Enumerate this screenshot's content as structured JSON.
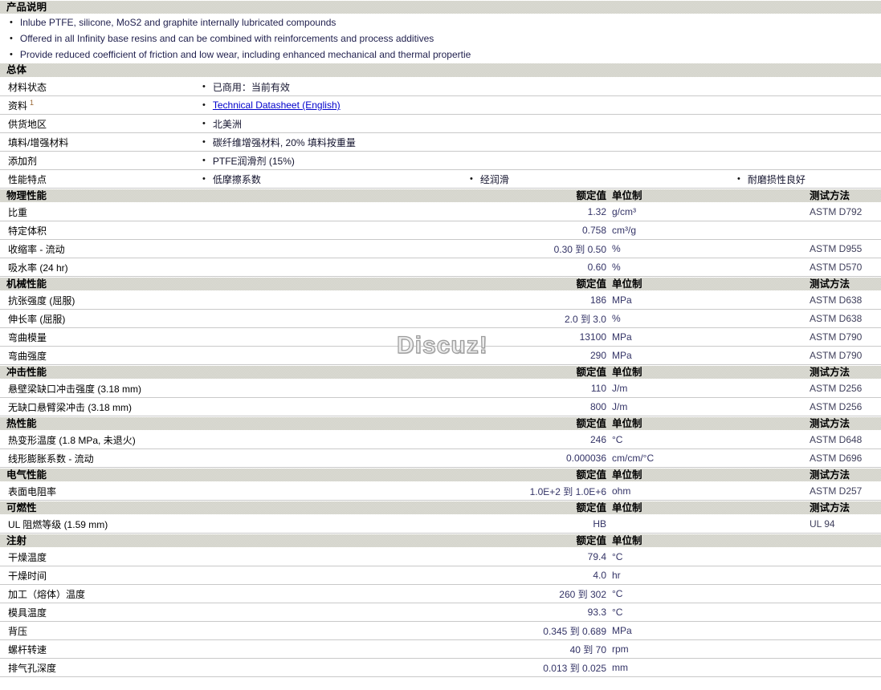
{
  "icons": {
    "bullet": "•"
  },
  "colors": {
    "link_blue": "#0000cc",
    "value_navy": "#333366",
    "header_gray": "#d6d6ce"
  },
  "watermark": "Discuz!",
  "product_description": {
    "title": "产品说明",
    "bullets": [
      "Inlube PTFE, silicone, MoS2 and graphite internally lubricated compounds",
      "Offered in all Infinity base resins and can be combined with reinforcements and process additives",
      "Provide reduced coefficient of friction and low wear, including enhanced mechanical and thermal propertie"
    ]
  },
  "general": {
    "title": "总体",
    "rows": [
      {
        "label": "材料状态",
        "sup": "",
        "values": [
          "已商用：当前有效"
        ]
      },
      {
        "label": "资料",
        "sup": "1",
        "values": [
          "Technical Datasheet (English)"
        ],
        "link": true
      },
      {
        "label": "供货地区",
        "sup": "",
        "values": [
          "北美洲"
        ]
      },
      {
        "label": "填料/增强材料",
        "sup": "",
        "values": [
          "碳纤维增强材料, 20% 填料按重量"
        ]
      },
      {
        "label": "添加剂",
        "sup": "",
        "values": [
          "PTFE润滑剂 (15%)"
        ]
      },
      {
        "label": "性能特点",
        "sup": "",
        "values": [
          "低摩擦系数",
          "经润滑",
          "耐磨损性良好"
        ]
      }
    ]
  },
  "columns": {
    "value_header": "额定值",
    "unit_header": "单位制",
    "method_header": "测试方法"
  },
  "sections": [
    {
      "title": "物理性能",
      "rows": [
        {
          "property": "比重",
          "value": "1.32",
          "unit": "g/cm³",
          "method": "ASTM D792"
        },
        {
          "property": "特定体积",
          "value": "0.758",
          "unit": "cm³/g",
          "method": ""
        },
        {
          "property": "收缩率 - 流动",
          "value": "0.30 到 0.50",
          "unit": "%",
          "method": "ASTM D955"
        },
        {
          "property": "吸水率 (24 hr)",
          "value": "0.60",
          "unit": "%",
          "method": "ASTM D570"
        }
      ]
    },
    {
      "title": "机械性能",
      "rows": [
        {
          "property": "抗张强度 (屈服)",
          "value": "186",
          "unit": "MPa",
          "method": "ASTM D638"
        },
        {
          "property": "伸长率 (屈服)",
          "value": "2.0 到 3.0",
          "unit": "%",
          "method": "ASTM D638"
        },
        {
          "property": "弯曲模量",
          "value": "13100",
          "unit": "MPa",
          "method": "ASTM D790"
        },
        {
          "property": "弯曲强度",
          "value": "290",
          "unit": "MPa",
          "method": "ASTM D790"
        }
      ]
    },
    {
      "title": "冲击性能",
      "rows": [
        {
          "property": "悬壁梁缺口冲击强度 (3.18 mm)",
          "value": "110",
          "unit": "J/m",
          "method": "ASTM D256"
        },
        {
          "property": "无缺口悬臂梁冲击 (3.18 mm)",
          "value": "800",
          "unit": "J/m",
          "method": "ASTM D256"
        }
      ]
    },
    {
      "title": "热性能",
      "rows": [
        {
          "property": "热变形温度 (1.8 MPa, 未退火)",
          "value": "246",
          "unit": "°C",
          "method": "ASTM D648"
        },
        {
          "property": "线形膨胀系数 - 流动",
          "value": "0.000036",
          "unit": "cm/cm/°C",
          "method": "ASTM D696"
        }
      ]
    },
    {
      "title": "电气性能",
      "rows": [
        {
          "property": "表面电阻率",
          "value": "1.0E+2 到 1.0E+6",
          "unit": "ohm",
          "method": "ASTM D257"
        }
      ]
    },
    {
      "title": "可燃性",
      "rows": [
        {
          "property": "UL 阻燃等级 (1.59 mm)",
          "value": "HB",
          "unit": "",
          "method": "UL 94"
        }
      ]
    },
    {
      "title": "注射",
      "rows": [
        {
          "property": "干燥温度",
          "value": "79.4",
          "unit": "°C",
          "method": ""
        },
        {
          "property": "干燥时间",
          "value": "4.0",
          "unit": "hr",
          "method": ""
        },
        {
          "property": "加工（熔体）温度",
          "value": "260 到 302",
          "unit": "°C",
          "method": ""
        },
        {
          "property": "模具温度",
          "value": "93.3",
          "unit": "°C",
          "method": ""
        },
        {
          "property": "背压",
          "value": "0.345 到 0.689",
          "unit": "MPa",
          "method": ""
        },
        {
          "property": "螺杆转速",
          "value": "40 到 70",
          "unit": "rpm",
          "method": ""
        },
        {
          "property": "排气孔深度",
          "value": "0.013 到 0.025",
          "unit": "mm",
          "method": ""
        }
      ]
    }
  ]
}
